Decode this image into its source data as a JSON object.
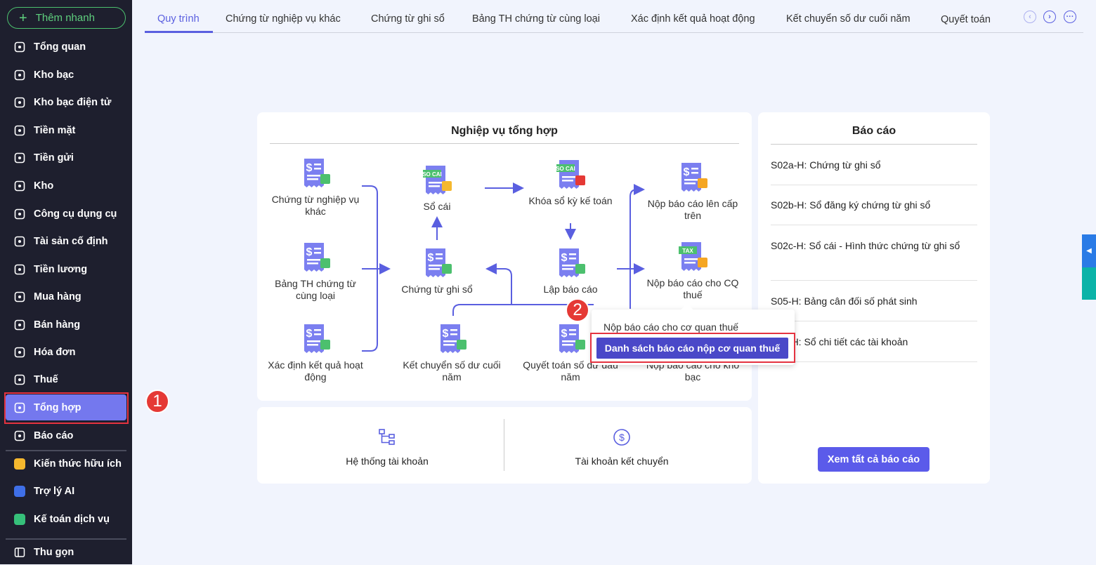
{
  "sidebar": {
    "quick_add": "Thêm nhanh",
    "items": [
      {
        "label": "Tổng quan",
        "icon": "pie-chart-icon"
      },
      {
        "label": "Kho bạc",
        "icon": "treasury-icon"
      },
      {
        "label": "Kho bạc điện tử",
        "icon": "e-treasury-icon"
      },
      {
        "label": "Tiền mặt",
        "icon": "cash-icon"
      },
      {
        "label": "Tiền gửi",
        "icon": "deposit-icon"
      },
      {
        "label": "Kho",
        "icon": "warehouse-icon"
      },
      {
        "label": "Công cụ dụng cụ",
        "icon": "tools-icon"
      },
      {
        "label": "Tài sản cố định",
        "icon": "truck-icon"
      },
      {
        "label": "Tiền lương",
        "icon": "salary-icon"
      },
      {
        "label": "Mua hàng",
        "icon": "cart-icon"
      },
      {
        "label": "Bán hàng",
        "icon": "store-icon"
      },
      {
        "label": "Hóa đơn",
        "icon": "invoice-icon"
      },
      {
        "label": "Thuế",
        "icon": "bank-icon"
      },
      {
        "label": "Tổng hợp",
        "icon": "summary-icon",
        "active": true
      },
      {
        "label": "Báo cáo",
        "icon": "report-icon"
      }
    ],
    "extra": [
      {
        "label": "Kiến thức hữu ích",
        "icon": "knowledge-icon",
        "color": "#f5b82e"
      },
      {
        "label": "Trợ lý AI",
        "icon": "ai-assistant-icon",
        "color": "#3f6fe8"
      },
      {
        "label": "Kế toán dịch vụ",
        "icon": "service-icon",
        "color": "#36c07a"
      }
    ],
    "collapse": "Thu gọn"
  },
  "tabs": [
    "Quy trình",
    "Chứng từ nghiệp vụ khác",
    "Chứng từ ghi sổ",
    "Bảng TH chứng từ cùng loại",
    "Xác định kết quả hoạt động",
    "Kết chuyển số dư cuối năm",
    "Quyết toán"
  ],
  "process": {
    "title": "Nghiệp vụ tổng hợp",
    "nodes": {
      "n1": "Chứng từ nghiệp vụ khác",
      "n2": "Bảng TH chứng từ cùng loại",
      "n3": "Xác định kết quả hoạt động",
      "n4": "Sổ cái",
      "n5": "Chứng từ ghi sổ",
      "n6": "Kết chuyển số dư cuối năm",
      "n7": "Khóa sổ kỳ kế toán",
      "n8": "Lập báo cáo",
      "n9": "Quyết toán số dư đầu năm",
      "n10": "Nộp báo cáo lên cấp trên",
      "n11": "Nộp báo cáo cho CQ thuế",
      "n12": "Nộp báo cáo cho kho bạc"
    },
    "icon_tags": {
      "ledger": "SO CAI",
      "tax": "TAX"
    }
  },
  "popup": {
    "item1": "Nộp báo cáo cho cơ quan thuế",
    "item2": "Danh sách báo cáo nộp cơ quan thuế"
  },
  "bottom": {
    "accounts": "Hệ thống tài khoản",
    "transfer": "Tài khoản kết chuyển"
  },
  "reports": {
    "title": "Báo cáo",
    "items": [
      "S02a-H: Chứng từ ghi sổ",
      "S02b-H: Sổ đăng ký chứng từ ghi sổ",
      "S02c-H: Sổ cái - Hình thức chứng từ ghi sổ",
      "S05-H: Bảng cân đối số phát sinh",
      "S06-H: Sổ chi tiết các tài khoản"
    ],
    "view_all": "Xem tất cả báo cáo"
  },
  "annotations": {
    "step1": "1",
    "step2": "2"
  },
  "colors": {
    "accent": "#5a5fe0",
    "sidebar": "#1e1f2e",
    "highlight": "#e53340",
    "icon": "#7b7ff0"
  }
}
